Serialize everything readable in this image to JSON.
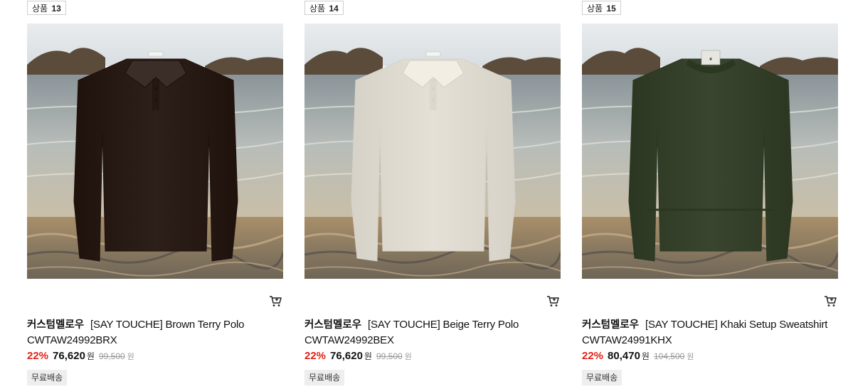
{
  "products": [
    {
      "rank_label": "상품",
      "rank_num": "13",
      "brand": "커스텀멜로우",
      "name": "[SAY TOUCHE] Brown Terry Polo",
      "code": "CWTAW24992BRX",
      "discount": "22%",
      "price": "76,620",
      "currency": "원",
      "original_price": "99,500",
      "original_currency": "원",
      "shipping": "무료배송",
      "garment_color": "#2d1f19",
      "garment_type": "polo",
      "icon": "cart-icon"
    },
    {
      "rank_label": "상품",
      "rank_num": "14",
      "brand": "커스텀멜로우",
      "name": "[SAY TOUCHE] Beige Terry Polo",
      "code": "CWTAW24992BEX",
      "discount": "22%",
      "price": "76,620",
      "currency": "원",
      "original_price": "99,500",
      "original_currency": "원",
      "shipping": "무료배송",
      "garment_color": "#e4e0d6",
      "garment_type": "polo",
      "icon": "cart-icon"
    },
    {
      "rank_label": "상품",
      "rank_num": "15",
      "brand": "커스텀멜로우",
      "name": "[SAY TOUCHE] Khaki Setup Sweatshirt",
      "code": "CWTAW24991KHX",
      "discount": "22%",
      "price": "80,470",
      "currency": "원",
      "original_price": "104,500",
      "original_currency": "원",
      "shipping": "무료배송",
      "garment_color": "#3a4530",
      "garment_type": "sweatshirt",
      "icon": "cart-icon"
    }
  ],
  "colors": {
    "discount": "#e32119",
    "strike": "#999999",
    "badge_bg": "#eeeeee"
  }
}
